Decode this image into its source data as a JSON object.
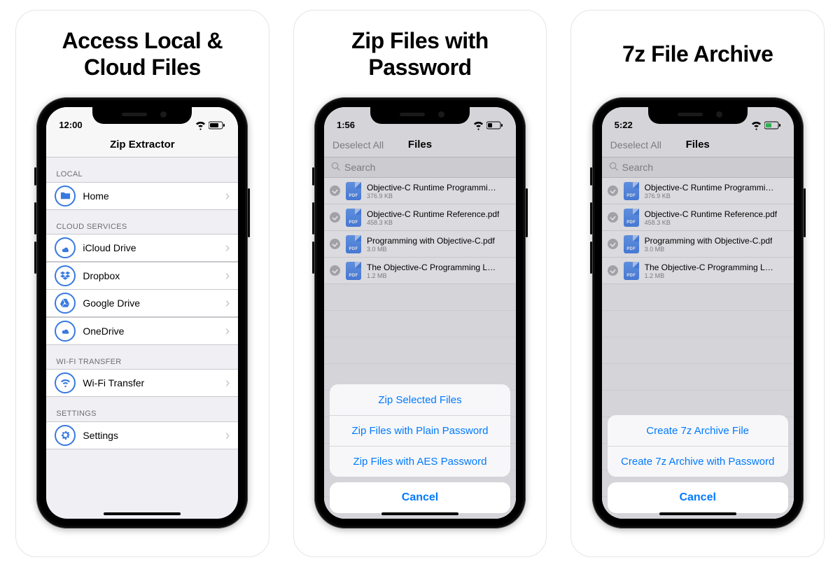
{
  "panel1": {
    "caption": "Access Local & Cloud Files",
    "time": "12:00",
    "title": "Zip Extractor",
    "sections": {
      "local_header": "LOCAL",
      "cloud_header": "CLOUD SERVICES",
      "wifi_header": "WI-FI TRANSFER",
      "settings_header": "SETTINGS"
    },
    "items": {
      "home": "Home",
      "icloud": "iCloud Drive",
      "dropbox": "Dropbox",
      "gdrive": "Google Drive",
      "onedrive": "OneDrive",
      "wifi": "Wi-Fi Transfer",
      "settings": "Settings"
    }
  },
  "panel2": {
    "caption": "Zip Files with Password",
    "time": "1:56",
    "nav_left": "Deselect All",
    "title": "Files",
    "search_placeholder": "Search",
    "files": [
      {
        "name": "Objective-C Runtime Programmin…",
        "size": "376.9 KB"
      },
      {
        "name": "Objective-C Runtime Reference.pdf",
        "size": "458.3 KB"
      },
      {
        "name": "Programming with Objective-C.pdf",
        "size": "3.0 MB"
      },
      {
        "name": "The Objective-C Programming Lan…",
        "size": "1.2 MB"
      }
    ],
    "sheet": {
      "opt1": "Zip Selected Files",
      "opt2": "Zip Files with Plain Password",
      "opt3": "Zip Files with AES Password",
      "cancel": "Cancel"
    }
  },
  "panel3": {
    "caption": "7z File Archive",
    "time": "5:22",
    "nav_left": "Deselect All",
    "title": "Files",
    "search_placeholder": "Search",
    "files": [
      {
        "name": "Objective-C Runtime Programmin…",
        "size": "376.9 KB"
      },
      {
        "name": "Objective-C Runtime Reference.pdf",
        "size": "458.3 KB"
      },
      {
        "name": "Programming with Objective-C.pdf",
        "size": "3.0 MB"
      },
      {
        "name": "The Objective-C Programming Lan…",
        "size": "1.2 MB"
      }
    ],
    "sheet": {
      "opt1": "Create 7z Archive File",
      "opt2": "Create 7z Archive with Password",
      "cancel": "Cancel"
    }
  }
}
